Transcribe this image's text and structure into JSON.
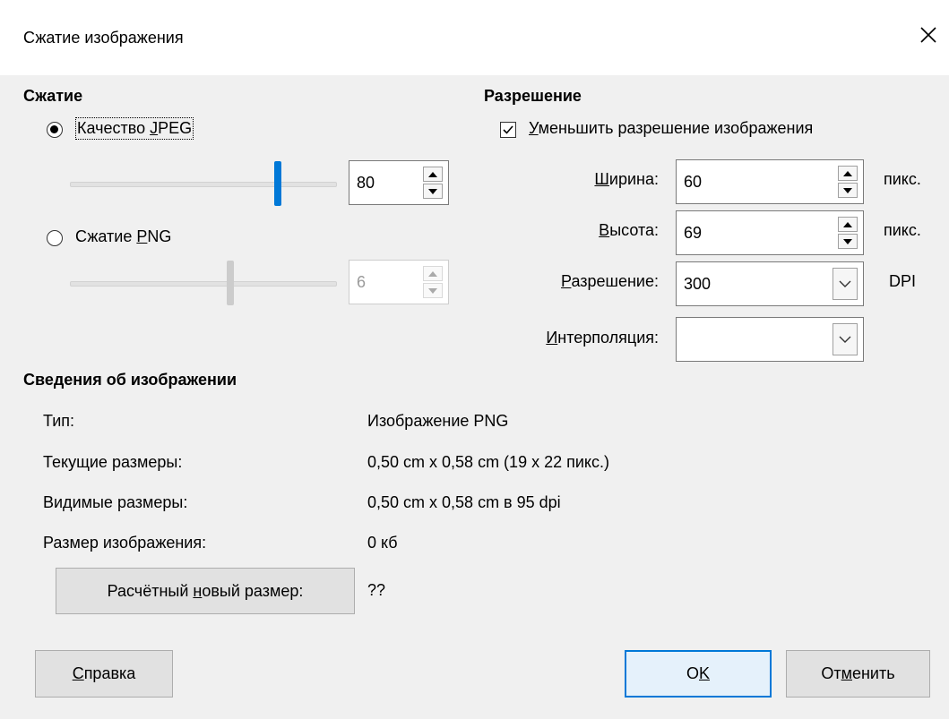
{
  "window": {
    "title": "Сжатие изображения"
  },
  "compression": {
    "heading": "Сжатие",
    "jpeg": {
      "label_pre": "Качество ",
      "label_ul": "J",
      "label_post": "PEG",
      "checked": true,
      "value": "80",
      "level": 80
    },
    "png": {
      "label_pre": "Сжатие ",
      "label_ul": "P",
      "label_post": "NG",
      "checked": false,
      "value": "6",
      "level": 6
    }
  },
  "resolution": {
    "heading": "Разрешение",
    "reduce": {
      "label_ul": "У",
      "label_post": "меньшить разрешение изображения",
      "checked": true
    },
    "width": {
      "label_ul": "Ш",
      "label_post": "ирина:",
      "value": "60",
      "unit": "пикс."
    },
    "height": {
      "label_ul": "В",
      "label_post": "ысота:",
      "value": "69",
      "unit": "пикс."
    },
    "dpi": {
      "label_ul": "Р",
      "label_post": "азрешение:",
      "value": "300",
      "unit": "DPI"
    },
    "interpolation": {
      "label_ul": "И",
      "label_post": "нтерполяция:",
      "value": ""
    }
  },
  "info": {
    "heading": "Сведения об изображении",
    "rows": [
      {
        "label": "Тип:",
        "value": "Изображение PNG"
      },
      {
        "label": "Текущие размеры:",
        "value": "0,50 cm x 0,58 cm (19 x 22 пикс.)"
      },
      {
        "label": "Видимые размеры:",
        "value": "0,50 cm x 0,58 cm в 95 dpi"
      },
      {
        "label": "Размер изображения:",
        "value": "0 кб"
      }
    ],
    "calc_button": {
      "label_pre": "Расчётный ",
      "label_ul": "н",
      "label_post": "овый размер:"
    },
    "calc_value": "??"
  },
  "buttons": {
    "help": {
      "label_ul": "С",
      "label_post": "правка"
    },
    "ok": {
      "label_pre": "O",
      "label_ul": "K",
      "label_post": ""
    },
    "cancel": {
      "label_pre": "От",
      "label_ul": "м",
      "label_post": "енить"
    }
  },
  "colors": {
    "accent": "#0078d7",
    "disabled_thumb": "#cccccc"
  },
  "icons": {
    "close": "close-icon",
    "spin_up": "triangle-up-icon",
    "spin_down": "triangle-down-icon",
    "dropdown": "chevron-down-icon",
    "check": "checkmark-icon"
  }
}
